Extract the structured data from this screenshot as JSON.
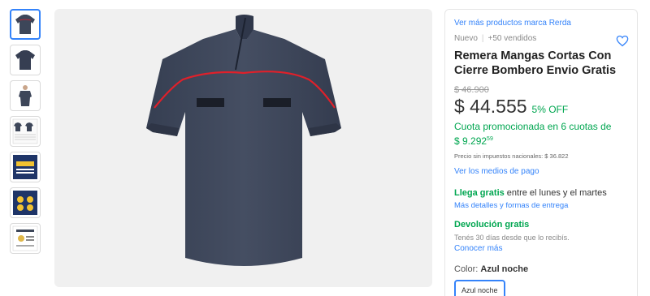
{
  "gallery": {
    "thumbnails": [
      {
        "name": "shirt-front",
        "active": true
      },
      {
        "name": "shirt-front-alt",
        "active": false
      },
      {
        "name": "shirt-model",
        "active": false
      },
      {
        "name": "size-chart",
        "active": false
      },
      {
        "name": "brand-card",
        "active": false
      },
      {
        "name": "badge-card",
        "active": false
      },
      {
        "name": "certificate-card",
        "active": false
      }
    ]
  },
  "product": {
    "brand_link": "Ver más productos marca Rerda",
    "condition": "Nuevo",
    "sold": "+50 vendidos",
    "title": "Remera Mangas Cortas Con Cierre Bombero Envio Gratis",
    "old_price": "$ 46.900",
    "price": "$ 44.555",
    "discount": "5% OFF",
    "installments_text": "Cuota promocionada en 6 cuotas de",
    "installment_amount": "$ 9.292",
    "installment_cents": "59",
    "tax_note": "Precio sin impuestos nacionales: $ 36.822",
    "payment_link": "Ver los medios de pago"
  },
  "shipping": {
    "highlight": "Llega gratis",
    "text": " entre el lunes y el martes",
    "link": "Más detalles y formas de entrega"
  },
  "returns": {
    "title": "Devolución gratis",
    "subtitle": "Tenés 30 días desde que lo recibís.",
    "link": "Conocer más"
  },
  "color": {
    "label": "Color: ",
    "selected": "Azul noche",
    "option": "Azul noche"
  },
  "colors": {
    "accent": "#3483fa",
    "green": "#00a650",
    "shirt": "#3d4659",
    "stripe": "#e0202a"
  }
}
